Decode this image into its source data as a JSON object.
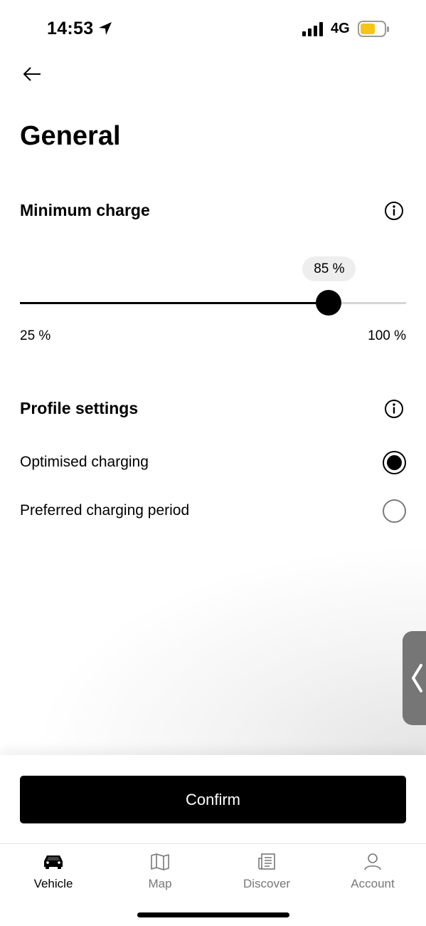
{
  "status_bar": {
    "time": "14:53",
    "network": "4G",
    "battery_color": "#f5c518"
  },
  "page": {
    "title": "General"
  },
  "minimum_charge": {
    "section_title": "Minimum charge",
    "value_label": "85 %",
    "value_percent": 85,
    "min_label": "25 %",
    "max_label": "100 %",
    "min": 25,
    "max": 100
  },
  "profile_settings": {
    "section_title": "Profile settings",
    "options": [
      {
        "label": "Optimised charging",
        "selected": true
      },
      {
        "label": "Preferred charging period",
        "selected": false
      }
    ]
  },
  "confirm_label": "Confirm",
  "tabs": [
    {
      "label": "Vehicle",
      "icon": "car-icon",
      "active": true
    },
    {
      "label": "Map",
      "icon": "map-icon",
      "active": false
    },
    {
      "label": "Discover",
      "icon": "newspaper-icon",
      "active": false
    },
    {
      "label": "Account",
      "icon": "user-icon",
      "active": false
    }
  ]
}
